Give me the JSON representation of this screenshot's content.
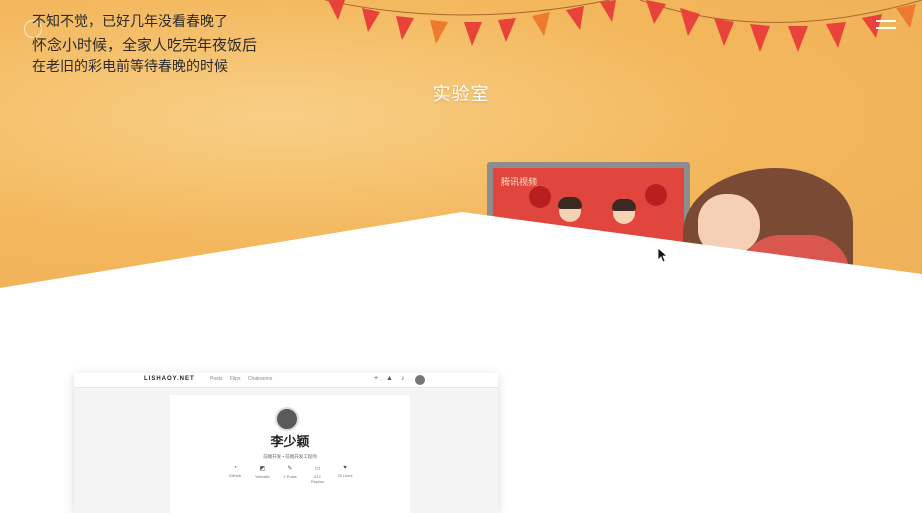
{
  "hero": {
    "poem": [
      "不知不觉，已好几年没看春晚了",
      "怀念小时候，全家人吃完年夜饭后",
      "在老旧的彩电前等待春晚的时候"
    ],
    "lab_title": "实验室",
    "tv_logo": "腾讯视频",
    "colors": {
      "sky": "#f3b65b",
      "flag_red": "#e8423a",
      "flag_orange": "#ee7a2e"
    }
  },
  "preview": {
    "brand": "LISHAOY.NET",
    "nav_links": [
      "Posts",
      "Flips",
      "Chatrooms"
    ],
    "name": "李少颖",
    "bio": "前端开发 ▪ 前端开发工程师",
    "stats": [
      {
        "icon": "github-icon",
        "label": "GitHub"
      },
      {
        "icon": "website-icon",
        "label": "Website"
      },
      {
        "icon": "posts-icon",
        "label": "1 Posts"
      },
      {
        "icon": "replies-icon",
        "label": "872 Replies"
      },
      {
        "icon": "likes-icon",
        "label": "32 Likes"
      }
    ]
  }
}
